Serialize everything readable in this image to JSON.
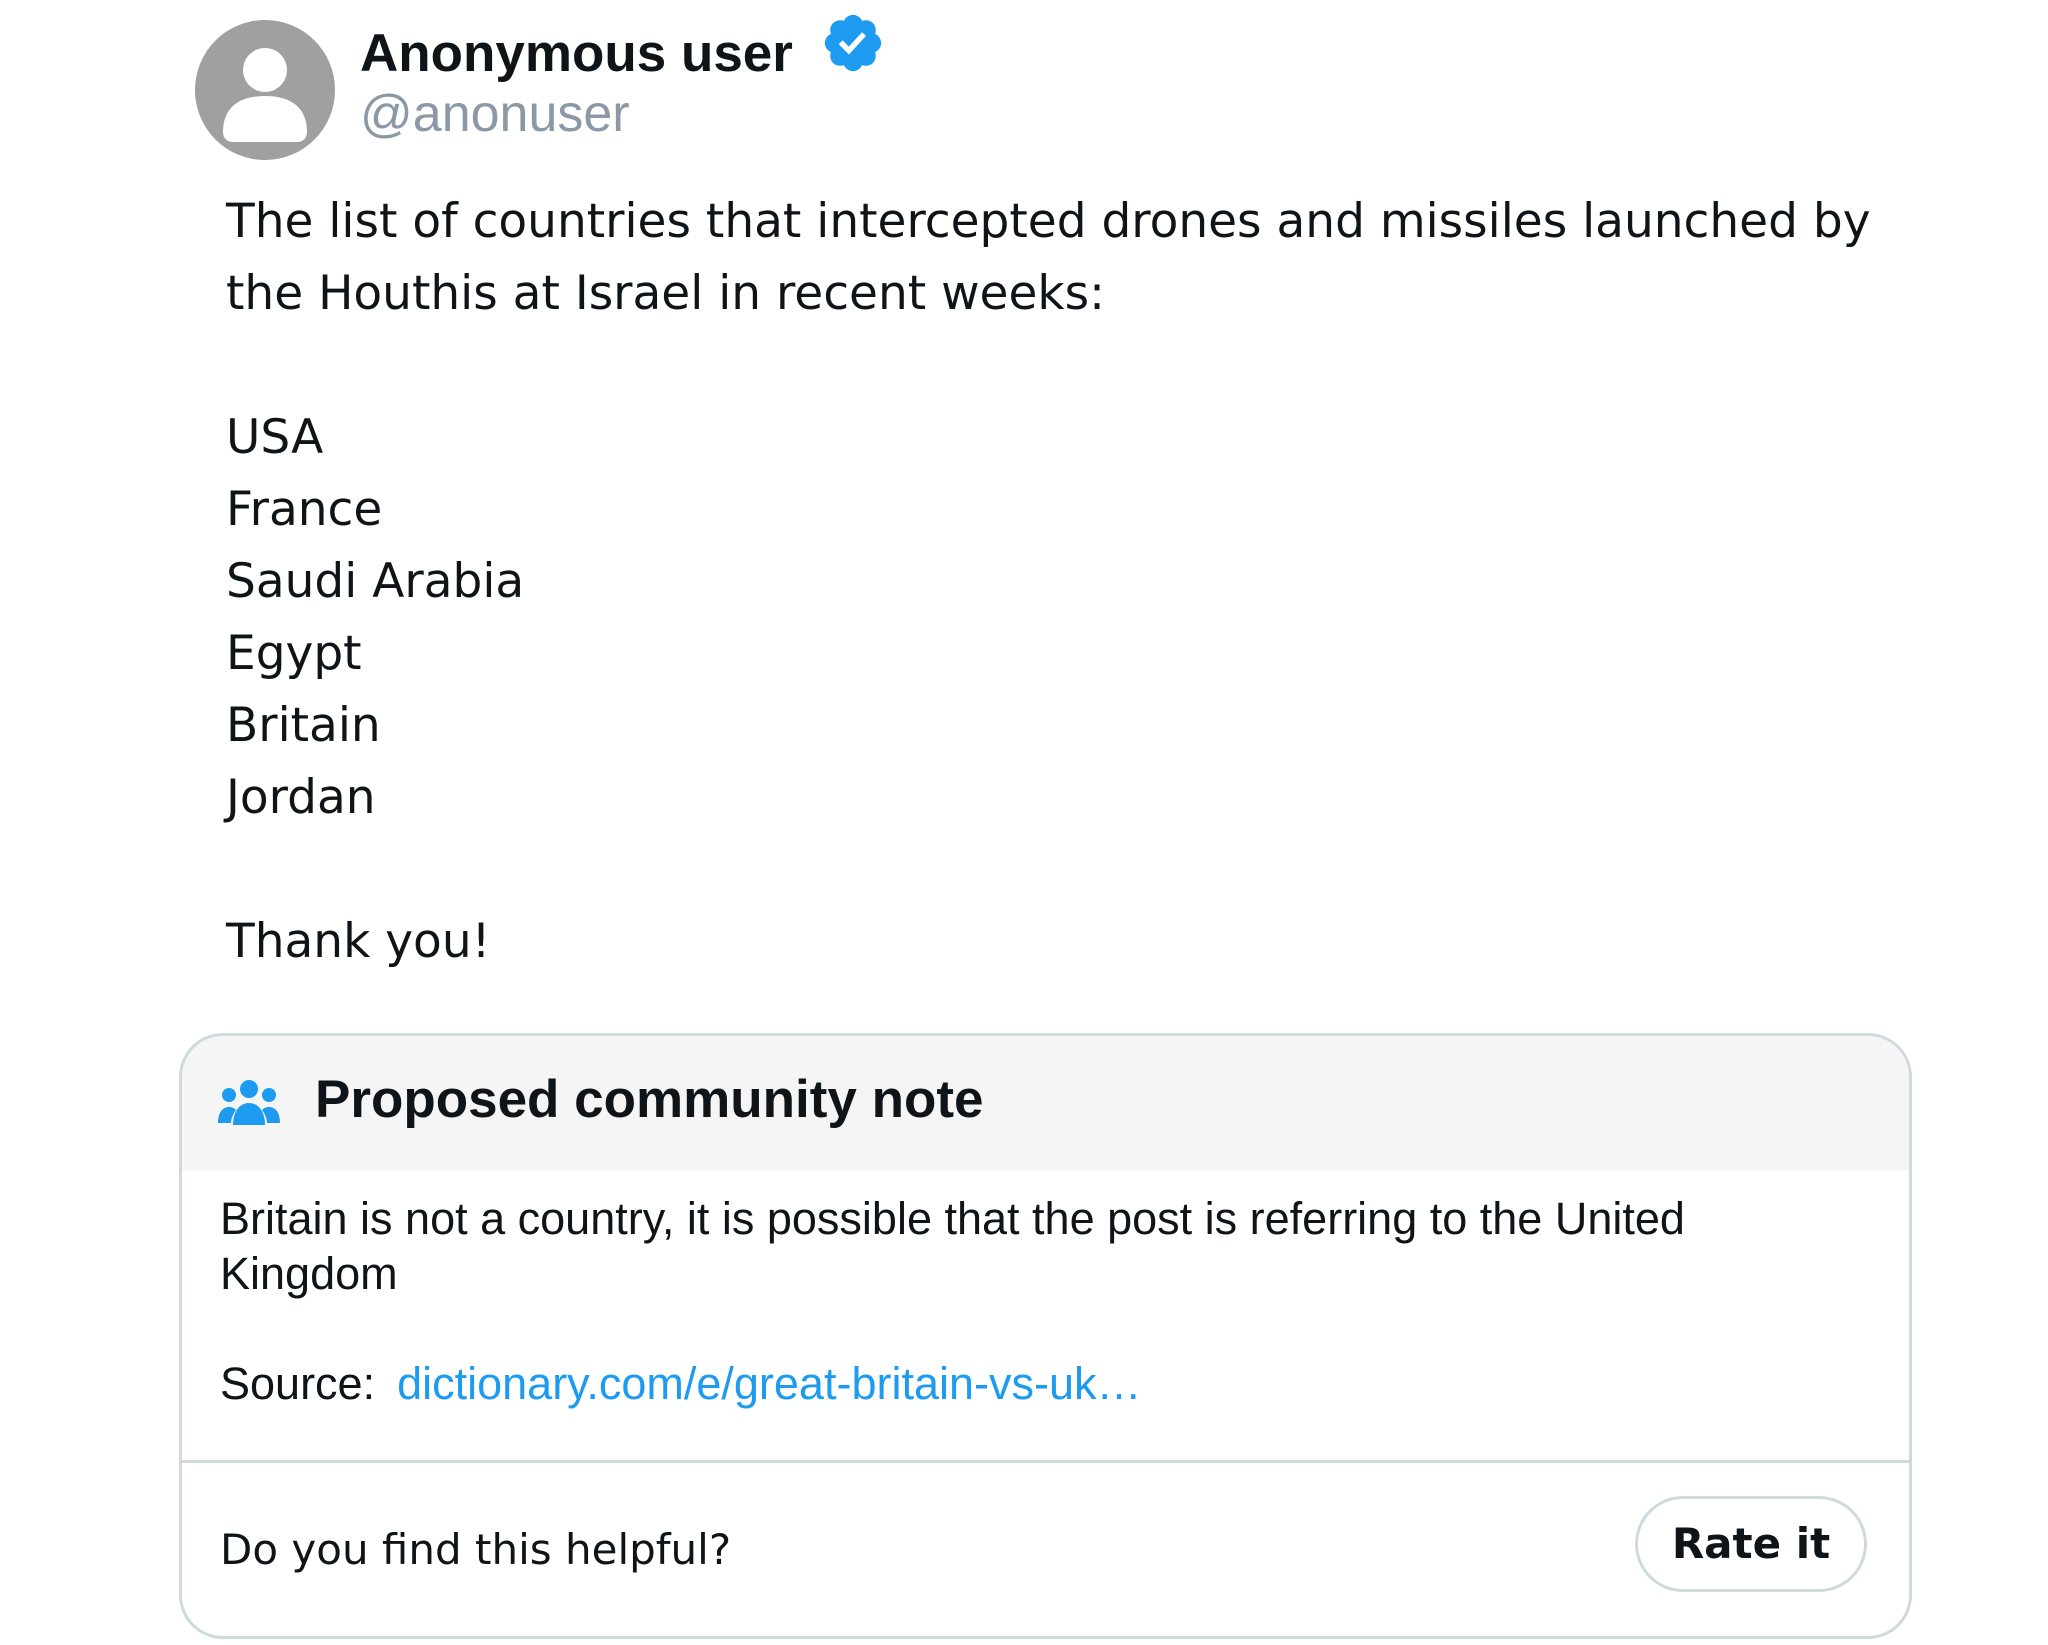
{
  "post": {
    "author": {
      "display_name": "Anonymous user",
      "handle": "@anonuser",
      "avatar_icon": "default-avatar-icon",
      "verified_icon": "verified-badge-icon"
    },
    "body": {
      "intro_line_1": "The list of countries that intercepted drones and missiles launched by",
      "intro_line_2": "the Houthis at Israel in recent weeks:",
      "countries": [
        "USA",
        "France",
        "Saudi Arabia",
        "Egypt",
        "Britain",
        "Jordan"
      ],
      "closing": "Thank you!"
    }
  },
  "community_note": {
    "icon": "people-group-icon",
    "title": "Proposed community note",
    "text": "Britain is not a country, it is possible that the post is referring to the United Kingdom",
    "source_label": "Source:",
    "source_link": "dictionary.com/e/great-britain-vs-uk…",
    "helpful_question": "Do you find this helpful?",
    "rate_button_label": "Rate it"
  },
  "colors": {
    "accent": "#1d9bf0",
    "avatar_bg": "#a0a0a0",
    "handle_gray": "#8b98a5",
    "border": "#cfd9de",
    "header_bg": "#f5f5f5",
    "text": "#0f1419"
  }
}
